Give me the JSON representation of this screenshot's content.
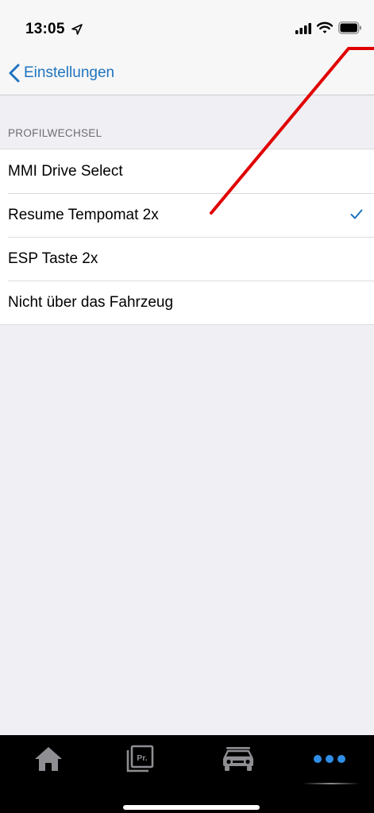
{
  "status_bar": {
    "time": "13:05"
  },
  "nav": {
    "back_label": "Einstellungen"
  },
  "section": {
    "header": "PROFILWECHSEL"
  },
  "list": {
    "items": [
      {
        "label": "MMI Drive Select",
        "selected": false
      },
      {
        "label": "Resume Tempomat 2x",
        "selected": true
      },
      {
        "label": "ESP Taste 2x",
        "selected": false
      },
      {
        "label": "Nicht über das Fahrzeug",
        "selected": false
      }
    ]
  },
  "tab_bar": {
    "tabs": [
      {
        "icon": "home-icon"
      },
      {
        "icon": "profile-icon",
        "glyph": "Pr."
      },
      {
        "icon": "car-icon"
      },
      {
        "icon": "more-icon"
      }
    ]
  },
  "colors": {
    "accent": "#1f74bf",
    "annotation": "#e10000",
    "tab_active": "#2f8fe8",
    "tab_inactive": "#8e8e93"
  }
}
